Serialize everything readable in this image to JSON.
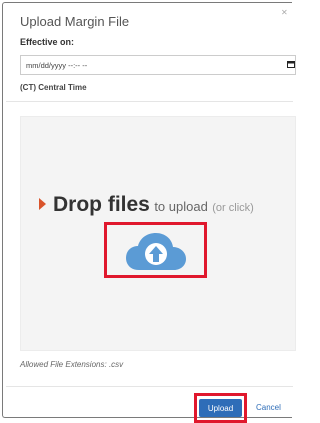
{
  "dialog": {
    "title": "Upload Margin File",
    "close_icon": "close-icon"
  },
  "form": {
    "effective_label": "Effective on:",
    "date_placeholder": "mm/dd/yyyy --:-- --",
    "calendar_icon": "calendar-icon",
    "timezone_label": "(CT) Central Time"
  },
  "dropzone": {
    "main": "Drop files",
    "sub": "to upload",
    "hint": "(or click)",
    "arrow_icon": "caret-right-icon",
    "cloud_icon": "cloud-upload-icon"
  },
  "allowed": {
    "label": "Allowed File Extensions:",
    "value": ".csv"
  },
  "footer": {
    "upload_label": "Upload",
    "cancel_label": "Cancel"
  },
  "colors": {
    "primary": "#2e6db8",
    "highlight": "#e0182d",
    "cloud": "#5b9bd5",
    "arrow": "#d9542b"
  }
}
